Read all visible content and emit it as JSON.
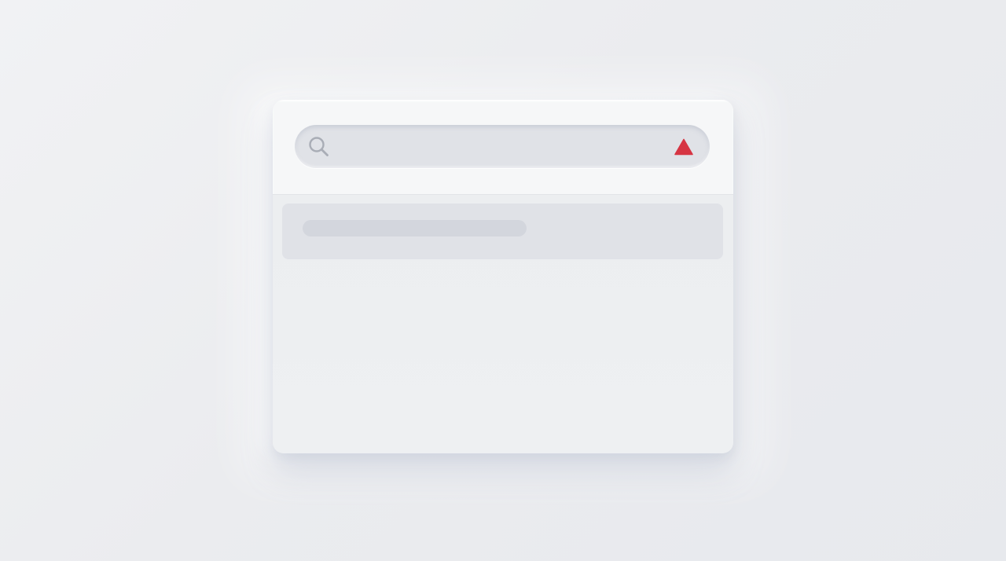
{
  "search": {
    "value": "",
    "placeholder": "",
    "icon": "search-icon",
    "status_icon": "warning-icon",
    "status_color": "#d63543"
  },
  "results": {
    "items": [
      {
        "label": ""
      }
    ]
  },
  "colors": {
    "background": "#eceef1",
    "panel": "#eeeff1",
    "header": "#f6f7f8",
    "search_field": "#e0e2e7",
    "placeholder_bar": "#d3d6dd",
    "icon_gray": "#a9adb6"
  }
}
